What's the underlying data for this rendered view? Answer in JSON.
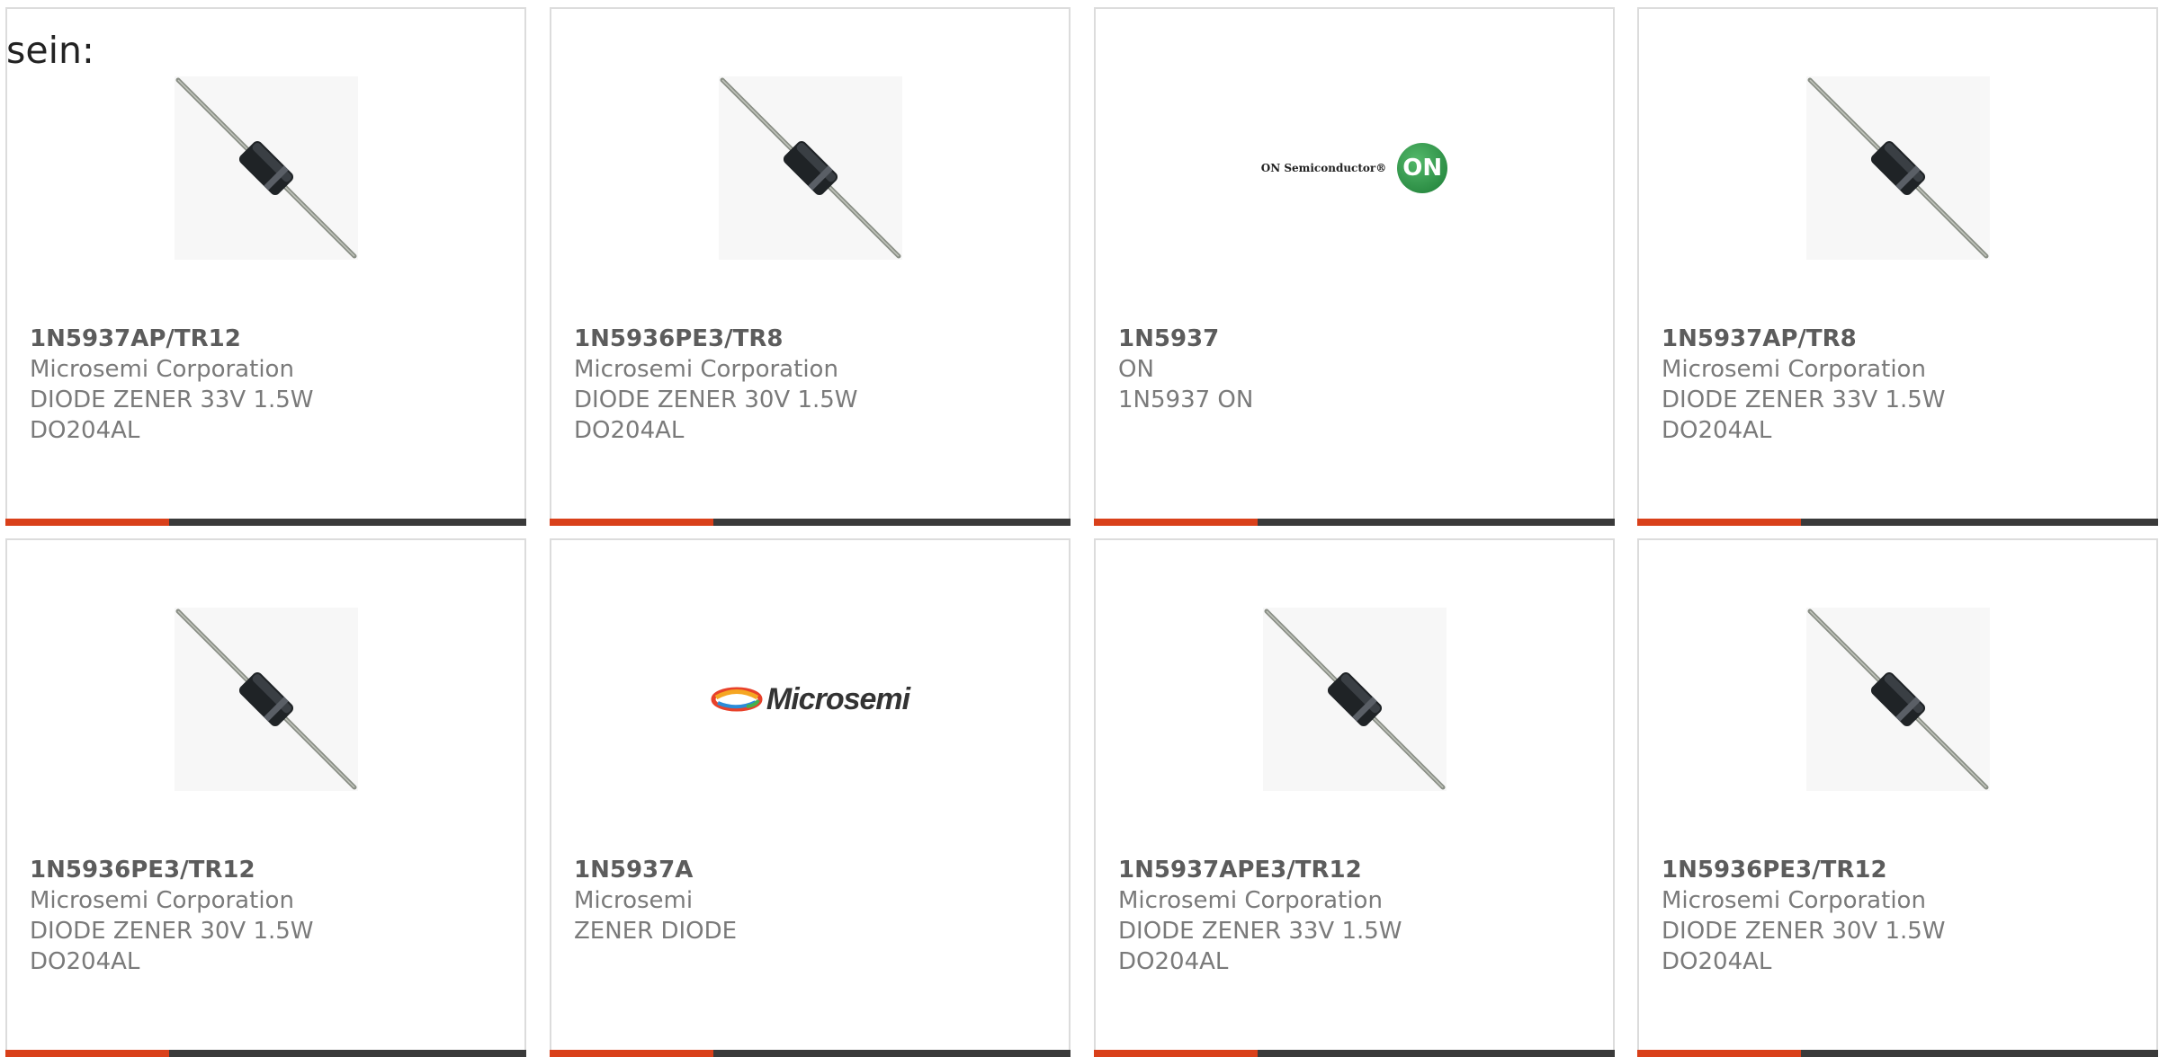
{
  "intro_text": "sein:",
  "colors": {
    "accent": "#d9401a",
    "bar": "#3a3a3a",
    "border": "#dcdcdc"
  },
  "products": [
    {
      "part": "1N5937AP/TR12",
      "manufacturer": "Microsemi Corporation",
      "desc1": "DIODE ZENER 33V 1.5W",
      "desc2": "DO204AL",
      "image": "diode-image"
    },
    {
      "part": "1N5936PE3/TR8",
      "manufacturer": "Microsemi Corporation",
      "desc1": "DIODE ZENER 30V 1.5W",
      "desc2": "DO204AL",
      "image": "diode-image"
    },
    {
      "part": "1N5937",
      "manufacturer": "ON",
      "desc1": "1N5937 ON",
      "desc2": "",
      "image": "on-semiconductor-logo",
      "logo_text": "ON Semiconductor®",
      "logo_badge": "ON"
    },
    {
      "part": "1N5937AP/TR8",
      "manufacturer": "Microsemi Corporation",
      "desc1": "DIODE ZENER 33V 1.5W",
      "desc2": "DO204AL",
      "image": "diode-image"
    },
    {
      "part": "1N5936PE3/TR12",
      "manufacturer": "Microsemi Corporation",
      "desc1": "DIODE ZENER 30V 1.5W",
      "desc2": "DO204AL",
      "image": "diode-image"
    },
    {
      "part": "1N5937A",
      "manufacturer": "Microsemi",
      "desc1": "ZENER DIODE",
      "desc2": "",
      "image": "microsemi-logo",
      "logo_text": "Microsemi"
    },
    {
      "part": "1N5937APE3/TR12",
      "manufacturer": "Microsemi Corporation",
      "desc1": "DIODE ZENER 33V 1.5W",
      "desc2": "DO204AL",
      "image": "diode-image"
    },
    {
      "part": "1N5936PE3/TR12",
      "manufacturer": "Microsemi Corporation",
      "desc1": "DIODE ZENER 30V 1.5W",
      "desc2": "DO204AL",
      "image": "diode-image"
    }
  ]
}
